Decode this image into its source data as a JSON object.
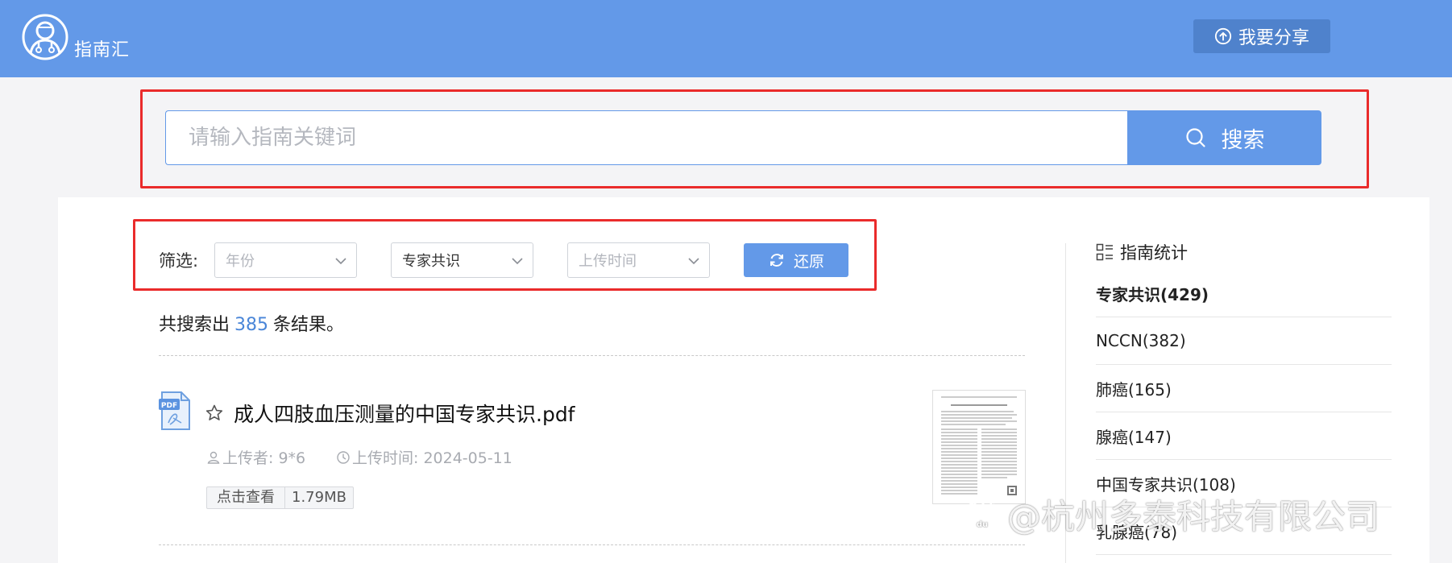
{
  "header": {
    "brand": "指南汇",
    "share_button": "我要分享"
  },
  "search": {
    "placeholder": "请输入指南关键词",
    "value": "",
    "button_label": "搜索"
  },
  "filters": {
    "label": "筛选:",
    "year": {
      "selected": "年份",
      "is_placeholder": true
    },
    "category": {
      "selected": "专家共识",
      "is_placeholder": false
    },
    "upload_time": {
      "selected": "上传时间",
      "is_placeholder": true
    },
    "restore_button": "还原"
  },
  "results": {
    "prefix": "共搜索出",
    "count": "385",
    "suffix": "条结果。",
    "items": [
      {
        "title": "成人四肢血压测量的中国专家共识.pdf",
        "uploader": "上传者: 9*6",
        "upload_time": "上传时间: 2024-05-11",
        "view_label": "点击查看",
        "size": "1.79MB",
        "file_type": "PDF"
      }
    ]
  },
  "sidebar": {
    "title": "指南统计",
    "items": [
      {
        "label": "专家共识(429)",
        "active": true
      },
      {
        "label": "NCCN(382)",
        "active": false
      },
      {
        "label": "肺癌(165)",
        "active": false
      },
      {
        "label": "腺癌(147)",
        "active": false
      },
      {
        "label": "中国专家共识(108)",
        "active": false
      },
      {
        "label": "乳腺癌(78)",
        "active": false
      }
    ]
  },
  "watermark": "@杭州多泰科技有限公司",
  "colors": {
    "header_bg": "#6399e8",
    "accent": "#6399e8",
    "annotation_red": "#ea2b2b",
    "count_blue": "#4a86d8"
  },
  "icons": {
    "logo": "doctor-logo-icon",
    "share": "upload-circle-icon",
    "search": "search-icon",
    "select": "chevron-down-icon",
    "restore": "refresh-icon",
    "file": "pdf-file-icon",
    "favorite": "star-outline-icon",
    "uploader": "user-icon",
    "time": "clock-icon",
    "sidebar": "grid-list-icon"
  }
}
